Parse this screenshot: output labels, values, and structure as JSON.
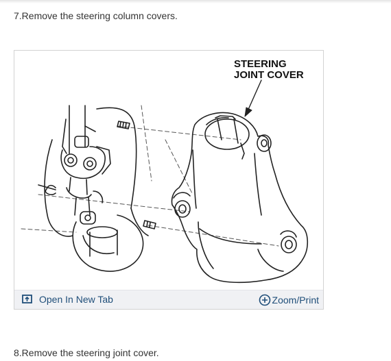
{
  "steps": [
    {
      "text": "7.Remove the steering column covers."
    },
    {
      "text": "8.Remove the steering joint cover."
    }
  ],
  "figure": {
    "callout_line1": "STEERING",
    "callout_line2": "JOINT COVER",
    "open_tab_label": "Open In New Tab",
    "zoom_label": "Zoom/Print"
  },
  "icons": {
    "open_tab": "open-in-new-tab-icon",
    "zoom": "plus-circle-icon"
  },
  "colors": {
    "link": "#1f4e79",
    "footer_bg": "#f0f1f4"
  }
}
